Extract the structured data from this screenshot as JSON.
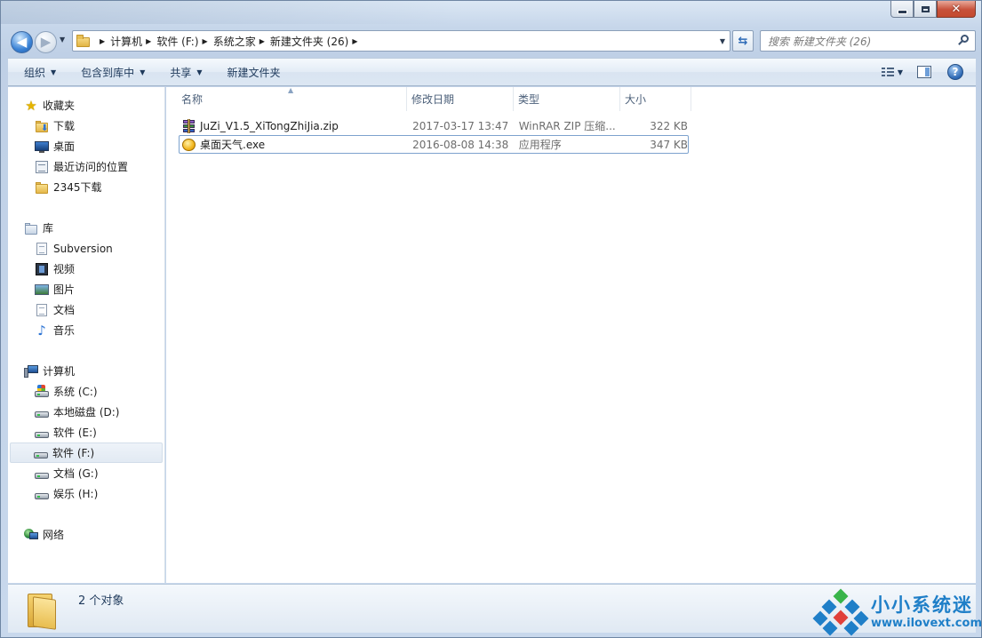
{
  "window": {
    "caption_min": "minimize",
    "caption_max": "maximize",
    "caption_close": "close"
  },
  "nav": {
    "back_glyph": "◀",
    "forward_glyph": "▶",
    "breadcrumbs": [
      "计算机",
      "软件 (F:)",
      "系统之家",
      "新建文件夹 (26)"
    ],
    "search_placeholder": "搜索 新建文件夹 (26)"
  },
  "toolbar": {
    "organize": "组织",
    "include_in_library": "包含到库中",
    "share": "共享",
    "new_folder": "新建文件夹"
  },
  "sidebar": {
    "favorites": {
      "label": "收藏夹",
      "items": [
        "下载",
        "桌面",
        "最近访问的位置",
        "2345下载"
      ]
    },
    "libraries": {
      "label": "库",
      "items": [
        "Subversion",
        "视频",
        "图片",
        "文档",
        "音乐"
      ]
    },
    "computer": {
      "label": "计算机",
      "items": [
        "系统 (C:)",
        "本地磁盘 (D:)",
        "软件 (E:)",
        "软件 (F:)",
        "文档 (G:)",
        "娱乐 (H:)"
      ],
      "selected": "软件 (F:)"
    },
    "network": {
      "label": "网络"
    }
  },
  "columns": {
    "name": "名称",
    "date": "修改日期",
    "type": "类型",
    "size": "大小"
  },
  "files": [
    {
      "name": "JuZi_V1.5_XiTongZhiJia.zip",
      "date": "2017-03-17 13:47",
      "type": "WinRAR ZIP 压缩...",
      "size": "322 KB",
      "icon": "winrar-archive-icon"
    },
    {
      "name": "桌面天气.exe",
      "date": "2016-08-08 14:38",
      "type": "应用程序",
      "size": "347 KB",
      "icon": "weather-app-icon"
    }
  ],
  "details": {
    "item_count": "2 个对象"
  },
  "watermark": {
    "title": "小小系统迷",
    "url": "www.ilovext.com"
  },
  "colors": {
    "accent": "#1f7fc8",
    "selection": "#7da2ce",
    "frame": "#c6d6ea"
  }
}
